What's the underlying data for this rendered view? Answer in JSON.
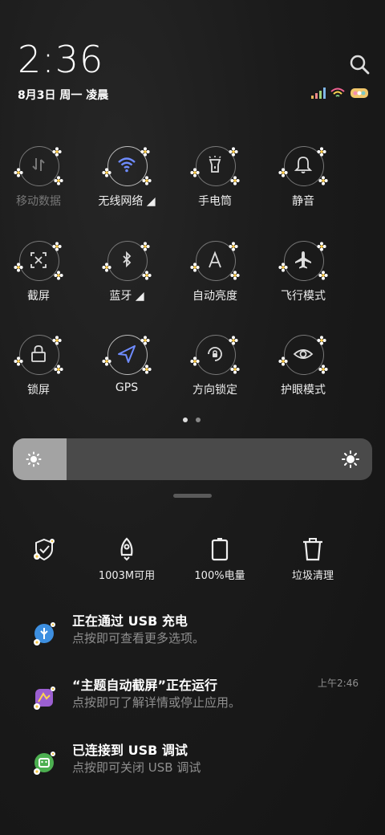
{
  "header": {
    "time": "2:36",
    "date": "8月3日 周一 凌晨"
  },
  "status": {
    "battery_color": "#f2c76b"
  },
  "tiles": [
    {
      "label": "移动数据",
      "icon": "mobile-data-icon",
      "state": "disabled"
    },
    {
      "label": "无线网络 ◢",
      "icon": "wifi-icon",
      "state": "active"
    },
    {
      "label": "手电筒",
      "icon": "flashlight-icon",
      "state": "off"
    },
    {
      "label": "静音",
      "icon": "bell-icon",
      "state": "off"
    },
    {
      "label": "截屏",
      "icon": "screenshot-icon",
      "state": "off"
    },
    {
      "label": "蓝牙 ◢",
      "icon": "bluetooth-icon",
      "state": "off"
    },
    {
      "label": "自动亮度",
      "icon": "auto-brightness-icon",
      "state": "off"
    },
    {
      "label": "飞行模式",
      "icon": "airplane-icon",
      "state": "off"
    },
    {
      "label": "锁屏",
      "icon": "lock-icon",
      "state": "off"
    },
    {
      "label": "GPS",
      "icon": "location-arrow-icon",
      "state": "active"
    },
    {
      "label": "方向锁定",
      "icon": "rotation-lock-icon",
      "state": "off"
    },
    {
      "label": "护眼模式",
      "icon": "eye-icon",
      "state": "off"
    }
  ],
  "pager": {
    "current": 1,
    "total": 2
  },
  "brightness": {
    "level": 0.15
  },
  "quick_actions": [
    {
      "label": "",
      "icon": "shield-icon"
    },
    {
      "label": "1003M可用",
      "icon": "rocket-icon"
    },
    {
      "label": "100%电量",
      "icon": "battery-icon"
    },
    {
      "label": "垃圾清理",
      "icon": "trash-icon"
    }
  ],
  "notifications": [
    {
      "title": "正在通过 USB 充电",
      "body": "点按即可查看更多选项。",
      "time": "",
      "icon": "usb-icon",
      "icon_color": "#3d8fe0"
    },
    {
      "title": "“主题自动截屏”正在运行",
      "body": "点按即可了解详情或停止应用。",
      "time": "上午2:46",
      "icon": "theme-app-icon",
      "icon_color": "#9b5fd0"
    },
    {
      "title": "已连接到 USB 调试",
      "body": "点按即可关闭 USB 调试",
      "time": "",
      "icon": "android-icon",
      "icon_color": "#4caf50"
    }
  ]
}
